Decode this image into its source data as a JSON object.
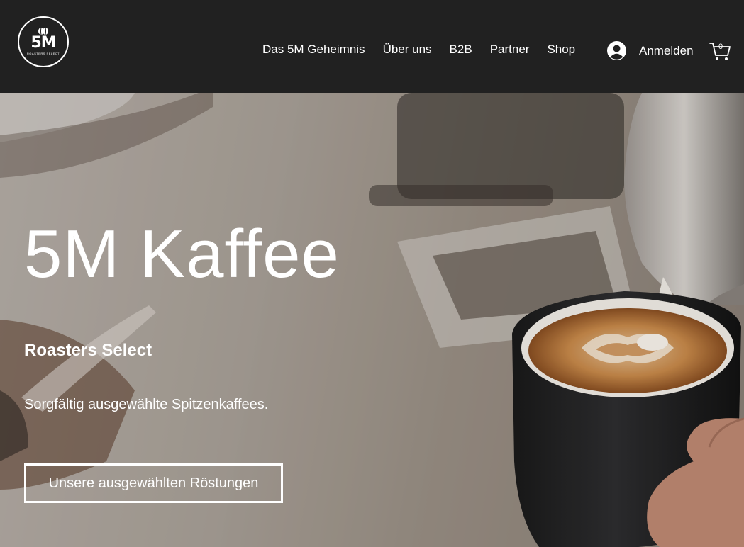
{
  "logo": {
    "mark": "5M",
    "sub": "ROASTERS SELECT"
  },
  "nav": {
    "items": [
      {
        "label": "Das 5M Geheimnis"
      },
      {
        "label": "Über uns"
      },
      {
        "label": "B2B"
      },
      {
        "label": "Partner"
      },
      {
        "label": "Shop"
      }
    ]
  },
  "account": {
    "login_label": "Anmelden"
  },
  "cart": {
    "count": "0"
  },
  "hero": {
    "title": "5M Kaffee",
    "subtitle": "Roasters Select",
    "text": "Sorgfältig ausgewählte Spitzenkaffees.",
    "button_label": "Unsere ausgewählten Röstungen"
  },
  "colors": {
    "header_bg": "#212121",
    "text": "#ffffff"
  },
  "icons": [
    "coffee-bean-icon",
    "user-avatar-icon",
    "shopping-cart-icon"
  ]
}
